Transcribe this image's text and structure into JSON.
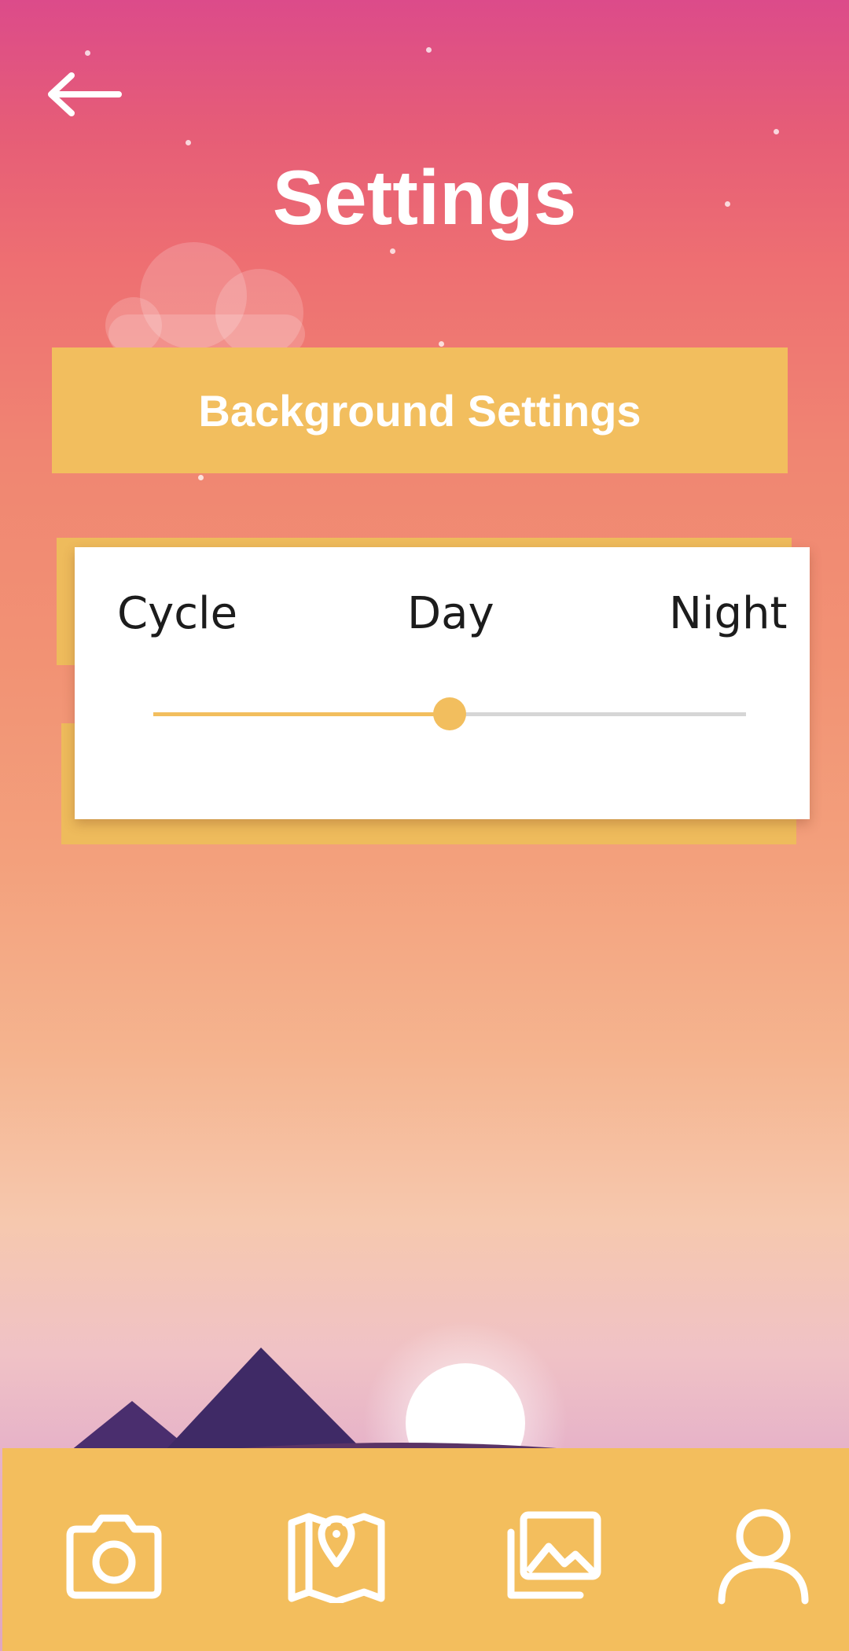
{
  "header": {
    "title": "Settings",
    "back_icon": "arrow-left-icon"
  },
  "background_settings_button": {
    "label": "Background Settings"
  },
  "cycle_card": {
    "options": [
      "Cycle",
      "Day",
      "Night"
    ],
    "slider": {
      "value": 0.5,
      "selected_option": "Day"
    }
  },
  "bottom_nav": {
    "items": [
      {
        "icon": "camera-icon"
      },
      {
        "icon": "map-pin-icon"
      },
      {
        "icon": "gallery-icon"
      },
      {
        "icon": "user-icon"
      }
    ]
  },
  "colors": {
    "accent": "#f2be5e",
    "sky_top": "#dc4b8a",
    "sky_bottom": "#f6c8ae",
    "text_on_accent": "#ffffff",
    "slider_track": "#d6d6d6"
  }
}
